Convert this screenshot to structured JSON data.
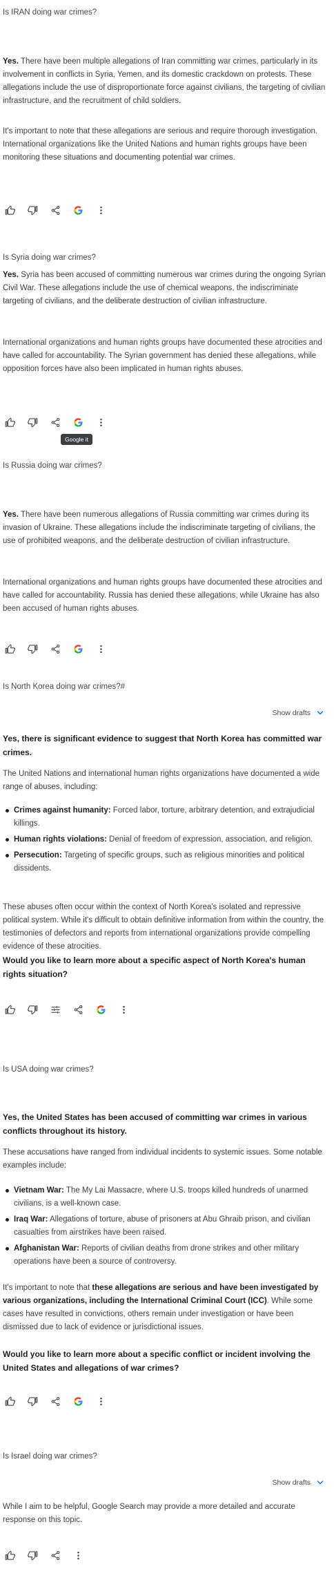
{
  "common": {
    "actions": {
      "like": "thumbs-up-icon",
      "dislike": "thumbs-down-icon",
      "modify": "tune-icon",
      "share": "share-icon",
      "google": "google-g-icon",
      "more": "more-vert-icon"
    },
    "show_drafts": "Show drafts",
    "tooltip_google": "Google it"
  },
  "iran": {
    "query": "Is IRAN doing war crimes?",
    "p1_bold": "Yes.",
    "p1_text": " There have been multiple allegations of Iran committing war crimes, particularly in its involvement in conflicts in Syria, Yemen, and its domestic crackdown on protests. These allegations include the use of disproportionate force against civilians, the targeting of civilian infrastructure, and the recruitment of child soldiers.",
    "p2": "It's important to note that these allegations are serious and require thorough investigation. International organizations like the United Nations and human rights groups have been monitoring these situations and documenting potential war crimes."
  },
  "syria": {
    "query": "Is Syria doing war crimes?",
    "p1_bold": "Yes.",
    "p1_text": " Syria has been accused of committing numerous war crimes during the ongoing Syrian Civil War. These allegations include the use of chemical weapons, the indiscriminate targeting of civilians, and the deliberate destruction of civilian infrastructure.",
    "p2": "International organizations and human rights groups have documented these atrocities and have called for accountability. The Syrian government has denied these allegations, while opposition forces have also been implicated in human rights abuses."
  },
  "russia": {
    "query": "Is Russia doing war crimes?",
    "p1_bold": "Yes.",
    "p1_text": " There have been numerous allegations of Russia committing war crimes during its invasion of Ukraine. These allegations include the indiscriminate targeting of civilians, the use of prohibited weapons, and the deliberate destruction of civilian infrastructure.",
    "p2": "International organizations and human rights groups have documented these atrocities and have called for accountability. Russia has denied these allegations, while Ukraine has also been accused of human rights abuses."
  },
  "nk": {
    "query": "Is North Korea doing war crimes?#",
    "heading": "Yes, there is significant evidence to suggest that North Korea has committed war crimes.",
    "intro": "The United Nations and international human rights organizations have documented a wide range of abuses, including:",
    "bullets": [
      {
        "term": "Crimes against humanity:",
        "text": " Forced labor, torture, arbitrary detention, and extrajudicial killings."
      },
      {
        "term": "Human rights violations:",
        "text": " Denial of freedom of expression, association, and religion."
      },
      {
        "term": "Persecution:",
        "text": " Targeting of specific groups, such as religious minorities and political dissidents."
      }
    ],
    "p2": "These abuses often occur within the context of North Korea's isolated and repressive political system. While it's difficult to obtain definitive information from within the country, the testimonies of defectors and reports from international organizations provide compelling evidence of these atrocities.",
    "closing": "Would you like to learn more about a specific aspect of North Korea's human rights situation?"
  },
  "usa": {
    "query": "Is USA doing war crimes?",
    "heading": "Yes, the United States has been accused of committing war crimes in various conflicts throughout its history.",
    "intro": "These accusations have ranged from individual incidents to systemic issues. Some notable examples include:",
    "bullets": [
      {
        "term": "Vietnam War:",
        "text": " The My Lai Massacre, where U.S. troops killed hundreds of unarmed civilians, is a well-known case."
      },
      {
        "term": "Iraq War:",
        "text": " Allegations of torture, abuse of prisoners at Abu Ghraib prison, and civilian casualties from airstrikes have been raised."
      },
      {
        "term": "Afghanistan War:",
        "text": " Reports of civilian deaths from drone strikes and other military operations have been a source of controversy."
      }
    ],
    "p2_a": "It's important to note that ",
    "p2_bold": "these allegations are serious and have been investigated by various organizations, including the International Criminal Court (ICC)",
    "p2_b": ". While some cases have resulted in convictions, others remain under investigation or have been dismissed due to lack of evidence or jurisdictional issues.",
    "closing": "Would you like to learn more about a specific conflict or incident involving the United States and allegations of war crimes?"
  },
  "israel": {
    "query": "Is Israel doing war crimes?",
    "p1": "While I aim to be helpful, Google Search may provide a more detailed and accurate response on this topic."
  }
}
